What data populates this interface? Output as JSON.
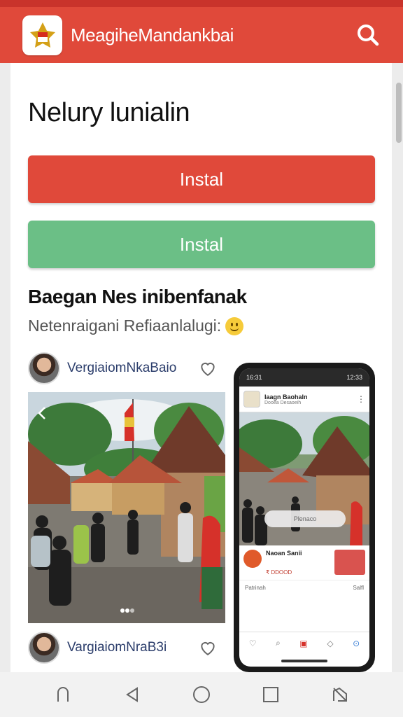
{
  "app": {
    "title": "MeagiheMandankbai"
  },
  "main": {
    "page_title": "Nelury lunialin",
    "primary_button": "Instal",
    "secondary_button": "Instal",
    "section_title": "Baegan Nes inibenfanak",
    "section_subtitle": "Netenraigani Refiaanlalugi:"
  },
  "posts": [
    {
      "user": "VergiaiomNkaBaio"
    },
    {
      "user": "VargiaiomNraB3i"
    }
  ],
  "phone": {
    "status_time": "16:31",
    "status_right": "12:33",
    "app_title": "Iaagn Baohaln",
    "app_subtitle": "Dooea Desaoeih",
    "overlay_button": "Plenaco",
    "card_title": "Naoan Sanii",
    "card_price": "₹ DDOOD",
    "footer_left": "Patrinah",
    "footer_right": "Salfl"
  },
  "colors": {
    "accent": "#e0493a",
    "green": "#6bbf86"
  },
  "icons": [
    "search-icon",
    "heart-icon",
    "back-icon",
    "home-icon",
    "recent-icon",
    "menu-icon"
  ]
}
